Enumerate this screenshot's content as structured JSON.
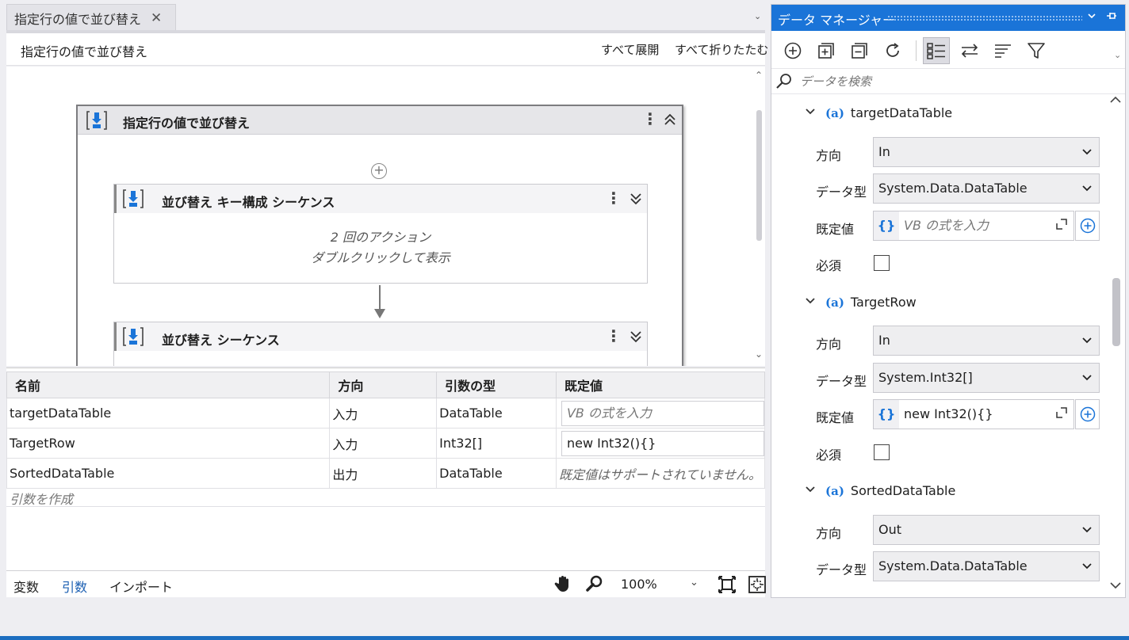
{
  "document_tab": {
    "title": "指定行の値で並び替え",
    "close": "✕"
  },
  "designer": {
    "title": "指定行の値で並び替え",
    "expand_all": "すべて展開",
    "collapse_all": "すべて折りたたむ"
  },
  "workflow": {
    "outer_sequence": {
      "title": "指定行の値で並び替え"
    },
    "inner_sequences": [
      {
        "title": "並び替え キー構成 シーケンス",
        "note_line1": "2 回のアクション",
        "note_line2": "ダブルクリックして表示"
      },
      {
        "title": "並び替え シーケンス"
      }
    ]
  },
  "arguments_table": {
    "columns": [
      "名前",
      "方向",
      "引数の型",
      "既定値"
    ],
    "rows": [
      {
        "name": "targetDataTable",
        "direction": "入力",
        "type": "DataTable",
        "default": "VB の式を入力"
      },
      {
        "name": "TargetRow",
        "direction": "入力",
        "type": "Int32[]",
        "default": "new Int32(){}"
      },
      {
        "name": "SortedDataTable",
        "direction": "出力",
        "type": "DataTable",
        "default": "既定値はサポートされていません。"
      }
    ],
    "create_placeholder": "引数を作成"
  },
  "status_bar": {
    "variables": "変数",
    "arguments": "引数",
    "imports": "インポート",
    "zoom": "100%"
  },
  "data_manager": {
    "title": "データ マネージャー",
    "search_placeholder": "データを検索",
    "labels": {
      "direction": "方向",
      "data_type": "データ型",
      "default": "既定値",
      "required": "必須"
    },
    "arguments": [
      {
        "name": "targetDataTable",
        "direction": "In",
        "type": "System.Data.DataTable",
        "default": "VB の式を入力"
      },
      {
        "name": "TargetRow",
        "direction": "In",
        "type": "System.Int32[]",
        "default": "new Int32(){}"
      },
      {
        "name": "SortedDataTable",
        "direction": "Out",
        "type": "System.Data.DataTable"
      }
    ]
  },
  "colors": {
    "accent": "#1a74d8",
    "link": "#1b5fb2"
  }
}
